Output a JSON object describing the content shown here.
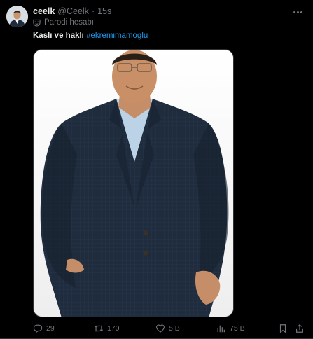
{
  "author": {
    "display_name": "ceelk",
    "handle": "@Ceelk",
    "separator": "·",
    "time": "15s",
    "label": "Parodi hesabı",
    "avatar_icon": "profile-photo"
  },
  "tweet": {
    "text": "Kaslı ve haklı",
    "hashtag": "#ekremimamoglu",
    "image_icon": "photo-man-in-suit"
  },
  "actions": {
    "reply_count": "29",
    "retweet_count": "170",
    "like_count": "5 B",
    "views_count": "75 B"
  },
  "colors": {
    "background": "#000000",
    "text": "#e7e9ea",
    "secondary": "#71767b",
    "link": "#1d9bf0"
  }
}
